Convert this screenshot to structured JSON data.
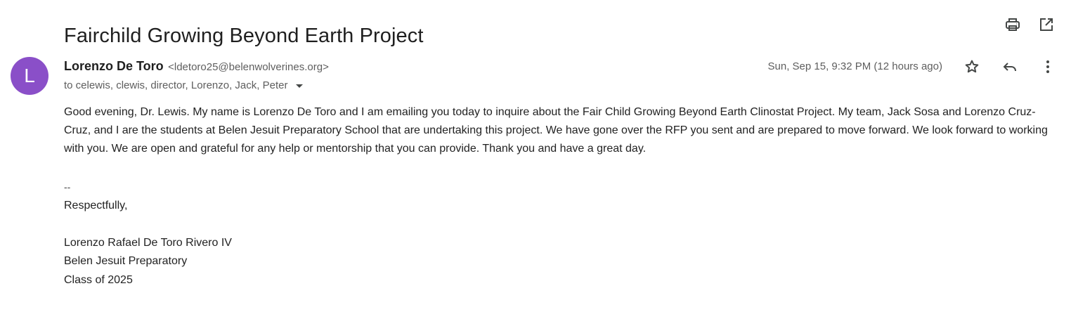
{
  "subject": "Fairchild Growing Beyond Earth Project",
  "toolbar": {
    "print_icon": "print-icon",
    "open_new_window_icon": "open-in-new-icon"
  },
  "sender": {
    "avatar_letter": "L",
    "avatar_color": "#8a4fc8",
    "name": "Lorenzo De Toro",
    "email": "<ldetoro25@belenwolverines.org>"
  },
  "recipients": "to celewis, clewis, director, Lorenzo, Jack, Peter",
  "date": "Sun, Sep 15, 9:32 PM (12 hours ago)",
  "message_actions": {
    "star_icon": "star-icon",
    "reply_icon": "reply-icon",
    "more_icon": "more-vert-icon"
  },
  "body": "Good evening, Dr. Lewis. My name is Lorenzo De Toro and I am emailing you today to inquire about the Fair Child Growing Beyond Earth Clinostat Project. My team, Jack Sosa and Lorenzo Cruz-Cruz, and I are the students at Belen Jesuit Preparatory School that are undertaking this project. We have gone over the RFP you sent and are prepared to move forward. We look forward to working with you. We are open and grateful for any help or mentorship that you can provide. Thank you and have a great day.",
  "signature": {
    "separator": "--",
    "closing": "Respectfully,",
    "name": "Lorenzo Rafael De Toro Rivero IV",
    "school": "Belen Jesuit Preparatory",
    "class": "Class of 2025"
  }
}
